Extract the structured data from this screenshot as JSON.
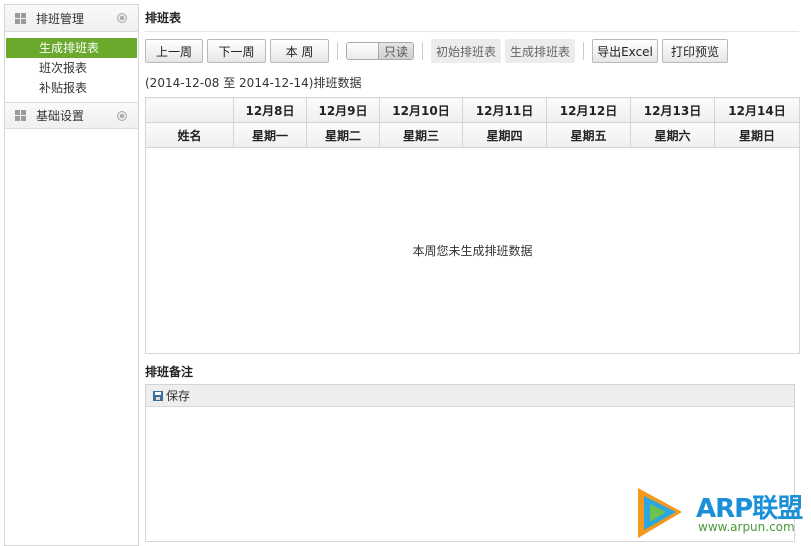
{
  "sidebar": {
    "groups": [
      {
        "label": "排班管理",
        "items": [
          "生成排班表",
          "班次报表",
          "补贴报表"
        ],
        "active_index": 0
      },
      {
        "label": "基础设置",
        "items": []
      }
    ]
  },
  "main": {
    "title": "排班表",
    "toolbar": {
      "prev_week": "上一周",
      "next_week": "下一周",
      "this_week": "本 周",
      "readonly_toggle": "只读",
      "init_schedule": "初始排班表",
      "generate_schedule": "生成排班表",
      "export_excel": "导出Excel",
      "print_preview": "打印预览"
    },
    "date_range": "(2014-12-08 至 2014-12-14)排班数据",
    "table": {
      "dates": [
        "12月8日",
        "12月9日",
        "12月10日",
        "12月11日",
        "12月12日",
        "12月13日",
        "12月14日"
      ],
      "name_header": "姓名",
      "weekdays": [
        "星期一",
        "星期二",
        "星期三",
        "星期四",
        "星期五",
        "星期六",
        "星期日"
      ],
      "empty_message": "本周您未生成排班数据"
    },
    "remark": {
      "title": "排班备注",
      "save_label": "保存"
    }
  },
  "watermark": {
    "brand": "ARP联盟",
    "url": "www.arpun.com"
  },
  "colors": {
    "active_nav": "#6aa92c",
    "border": "#d5d5d5"
  }
}
